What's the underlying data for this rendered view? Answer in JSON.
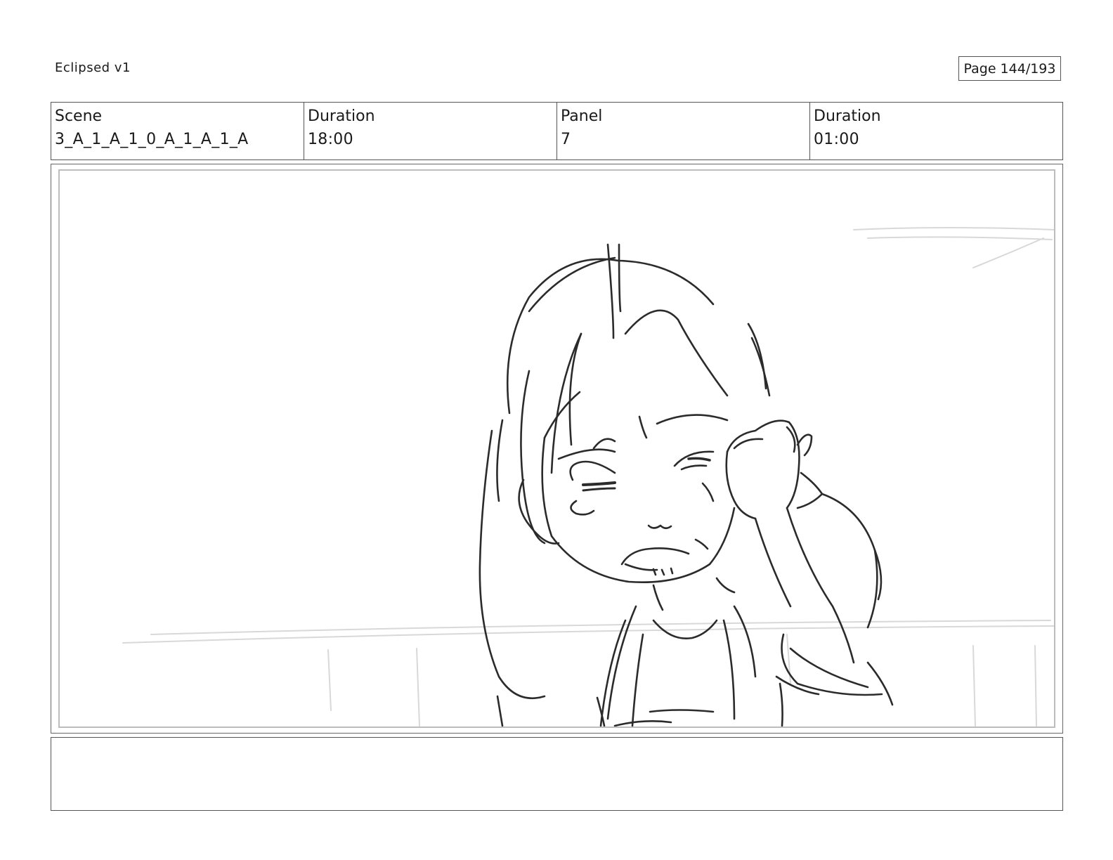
{
  "header": {
    "doc_title": "Eclipsed v1",
    "page_label": "Page 144/193"
  },
  "info": {
    "scene_label": "Scene",
    "scene_value": "3_A_1_A_1_0_A_1_A_1_A",
    "scene_duration_label": "Duration",
    "scene_duration_value": "18:00",
    "panel_label": "Panel",
    "panel_value": "7",
    "panel_duration_label": "Duration",
    "panel_duration_value": "01:00"
  },
  "notes": {
    "text": ""
  },
  "colors": {
    "sketch_line": "#2b2b2b",
    "background_line": "#d8d8d8",
    "frame_border": "#555555"
  }
}
